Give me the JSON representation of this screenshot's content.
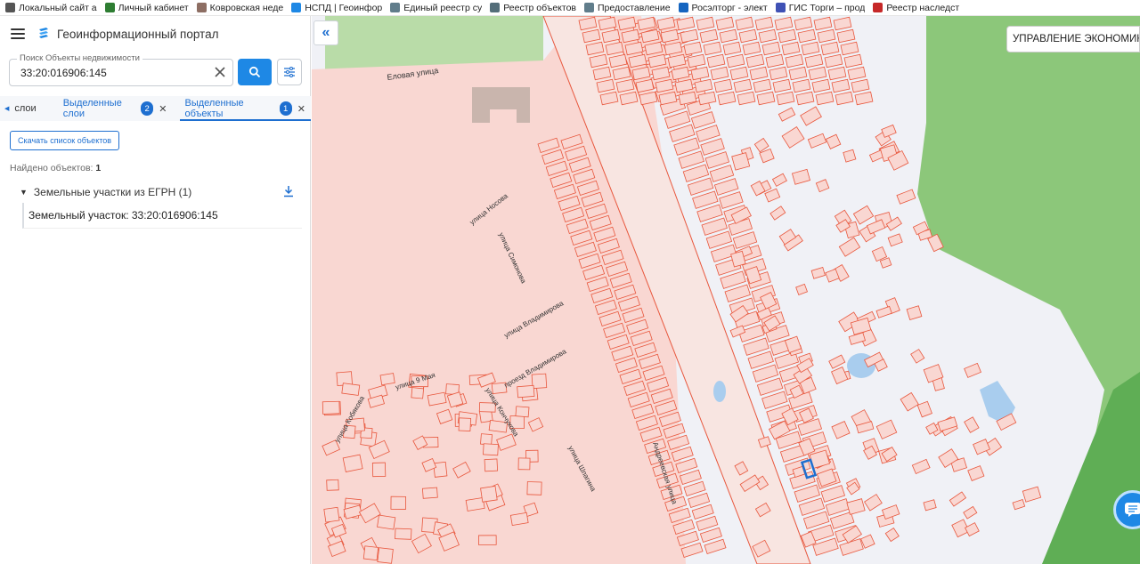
{
  "bookmarks": [
    {
      "label": "Локальный сайт а",
      "icon": "document-icon",
      "color": "#555555"
    },
    {
      "label": "Личный кабинет",
      "icon": "cabinet-icon",
      "color": "#2e7d32"
    },
    {
      "label": "Ковровская неде",
      "icon": "news-icon",
      "color": "#8d6e63"
    },
    {
      "label": "НСПД | Геоинфор",
      "icon": "nspd-icon",
      "color": "#1e88e5"
    },
    {
      "label": "Единый реестр су",
      "icon": "registry-icon",
      "color": "#607d8b"
    },
    {
      "label": "Реестр объектов",
      "icon": "objects-icon",
      "color": "#546e7a"
    },
    {
      "label": "Предоставление",
      "icon": "globe-icon",
      "color": "#607d8b"
    },
    {
      "label": "Росэлторг - элект",
      "icon": "roseltorg-icon",
      "color": "#1565c0"
    },
    {
      "label": "ГИС Торги – прод",
      "icon": "gis-icon",
      "color": "#3f51b5"
    },
    {
      "label": "Реестр наследст",
      "icon": "inheritance-icon",
      "color": "#c62828"
    }
  ],
  "header": {
    "title": "Геоинформационный портал"
  },
  "search": {
    "label": "Поиск Объекты недвижимости",
    "value": "33:20:016906:145"
  },
  "tabs": [
    {
      "label": "слои"
    },
    {
      "label": "Выделенные слои",
      "badge": "2"
    },
    {
      "label": "Выделенные объекты",
      "badge": "1"
    }
  ],
  "results": {
    "download_label": "Скачать список объектов",
    "found_label": "Найдено объектов:",
    "found_count": "1",
    "group_label": "Земельные участки из ЕГРН (1)",
    "item_label": "Земельный участок: 33:20:016906:145"
  },
  "map": {
    "org_label": "УПРАВЛЕНИЕ ЭКОНОМИК",
    "streets": [
      "Еловая улица",
      "улица Носова",
      "улица Симонова",
      "улица Владимирова",
      "проезд Владимирова",
      "улица 9 Мая",
      "улица Кобякова",
      "улица Кончукова",
      "улица Шпагина",
      "Андреевская улица"
    ],
    "colors": {
      "parcel_fill": "#f9d7d2",
      "parcel_stroke": "#e8573d",
      "forest": "#8cc77a",
      "water": "#a9cdee",
      "highlight": "#1e6fd0"
    }
  }
}
